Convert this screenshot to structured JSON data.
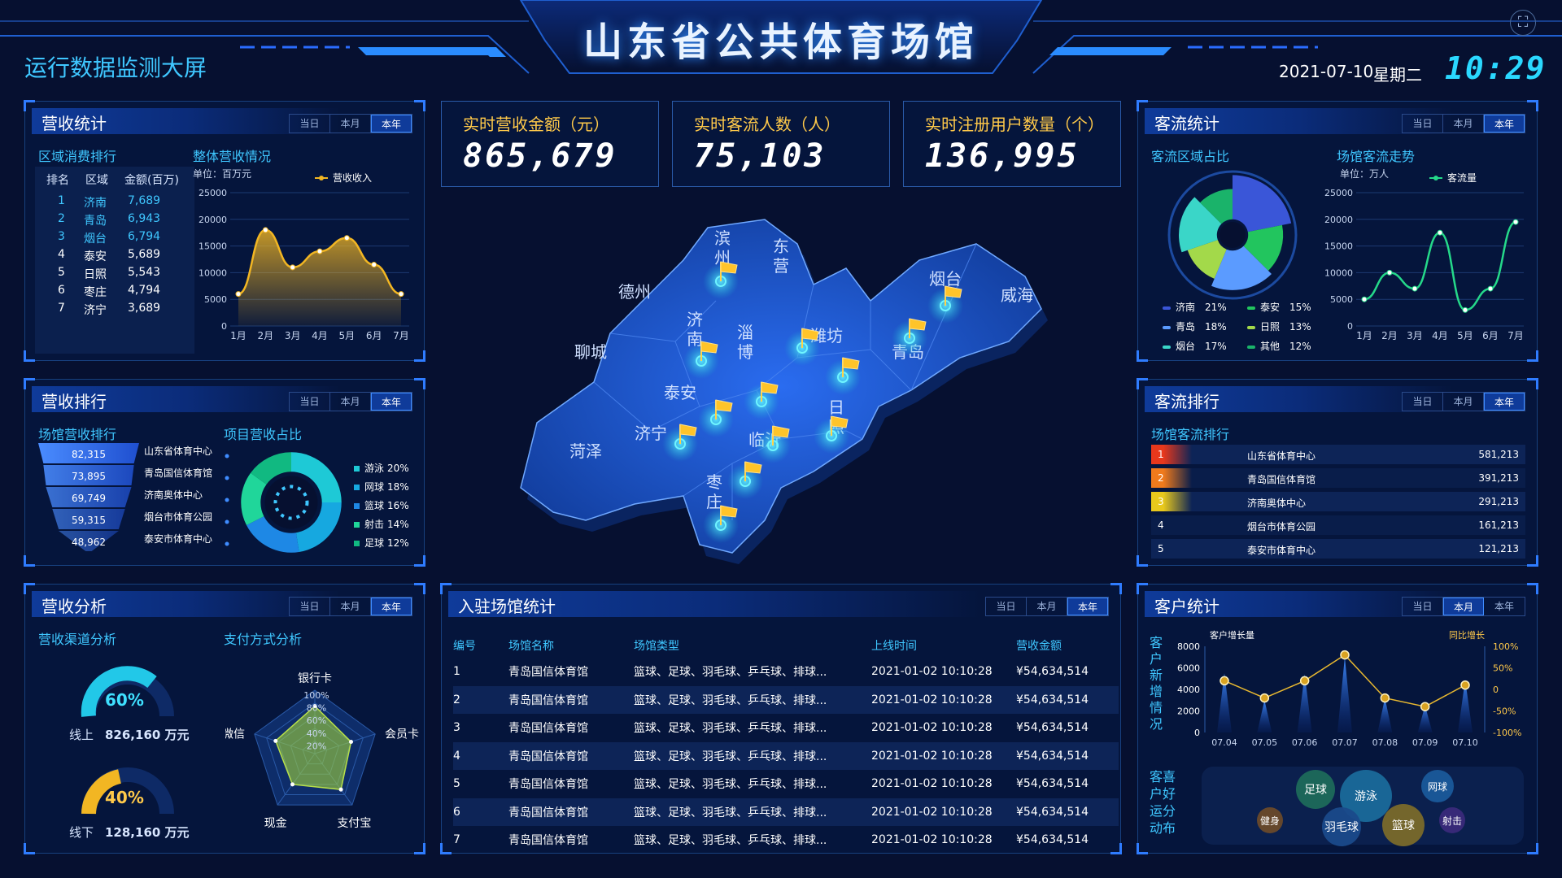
{
  "header": {
    "title": "山东省公共体育场馆",
    "subtitle": "运行数据监测大屏",
    "date": "2021-07-10",
    "weekday": "星期二",
    "time": "10:29"
  },
  "tabs": [
    "当日",
    "本月",
    "本年"
  ],
  "kpis": [
    {
      "label": "实时营收金额（元）",
      "value": "865,679"
    },
    {
      "label": "实时客流人数（人）",
      "value": "75,103"
    },
    {
      "label": "实时注册用户数量（个）",
      "value": "136,995"
    }
  ],
  "revenue_stats": {
    "title": "营收统计",
    "region_title": "区域消费排行",
    "headers": [
      "排名",
      "区域",
      "金额(百万)"
    ],
    "rows": [
      {
        "rank": "1",
        "region": "济南",
        "amount": "7,689"
      },
      {
        "rank": "2",
        "region": "青岛",
        "amount": "6,943"
      },
      {
        "rank": "3",
        "region": "烟台",
        "amount": "6,794"
      },
      {
        "rank": "4",
        "region": "泰安",
        "amount": "5,689"
      },
      {
        "rank": "5",
        "region": "日照",
        "amount": "5,543"
      },
      {
        "rank": "6",
        "region": "枣庄",
        "amount": "4,794"
      },
      {
        "rank": "7",
        "region": "济宁",
        "amount": "3,689"
      }
    ],
    "overall_title": "整体营收情况",
    "unit": "单位：百万元"
  },
  "revenue_rank": {
    "title": "营收排行",
    "venue_title": "场馆营收排行",
    "project_title": "项目营收占比",
    "funnel_values": [
      "82,315",
      "73,895",
      "69,749",
      "59,315",
      "48,962"
    ],
    "funnel_names": [
      "山东省体育中心",
      "青岛国信体育馆",
      "济南奥体中心",
      "烟台市体育公园",
      "泰安市体育中心"
    ]
  },
  "revenue_analysis": {
    "title": "营收分析",
    "channel_title": "营收渠道分析",
    "online_pct": "60%",
    "online_label": "线上",
    "online_value": "826,160 万元",
    "offline_pct": "40%",
    "offline_label": "线下",
    "offline_value": "128,160 万元",
    "payment_title": "支付方式分析",
    "radar_ticks": [
      "100%",
      "80%",
      "60%",
      "40%",
      "20%"
    ]
  },
  "venues": {
    "title": "入驻场馆统计",
    "headers": [
      "编号",
      "场馆名称",
      "场馆类型",
      "上线时间",
      "营收金额"
    ],
    "rows": [
      {
        "id": "1",
        "name": "青岛国信体育馆",
        "type": "篮球、足球、羽毛球、乒乓球、排球...",
        "time": "2021-01-02 10:10:28",
        "amount": "¥54,634,514"
      },
      {
        "id": "2",
        "name": "青岛国信体育馆",
        "type": "篮球、足球、羽毛球、乒乓球、排球...",
        "time": "2021-01-02 10:10:28",
        "amount": "¥54,634,514"
      },
      {
        "id": "3",
        "name": "青岛国信体育馆",
        "type": "篮球、足球、羽毛球、乒乓球、排球...",
        "time": "2021-01-02 10:10:28",
        "amount": "¥54,634,514"
      },
      {
        "id": "4",
        "name": "青岛国信体育馆",
        "type": "篮球、足球、羽毛球、乒乓球、排球...",
        "time": "2021-01-02 10:10:28",
        "amount": "¥54,634,514"
      },
      {
        "id": "5",
        "name": "青岛国信体育馆",
        "type": "篮球、足球、羽毛球、乒乓球、排球...",
        "time": "2021-01-02 10:10:28",
        "amount": "¥54,634,514"
      },
      {
        "id": "6",
        "name": "青岛国信体育馆",
        "type": "篮球、足球、羽毛球、乒乓球、排球...",
        "time": "2021-01-02 10:10:28",
        "amount": "¥54,634,514"
      },
      {
        "id": "7",
        "name": "青岛国信体育馆",
        "type": "篮球、足球、羽毛球、乒乓球、排球...",
        "time": "2021-01-02 10:10:28",
        "amount": "¥54,634,514"
      }
    ]
  },
  "traffic_stats": {
    "title": "客流统计",
    "region_title": "客流区域占比",
    "trend_title": "场馆客流走势",
    "unit": "单位：万人"
  },
  "traffic_rank": {
    "title": "客流排行",
    "subtitle": "场馆客流排行",
    "rows": [
      {
        "rank": "1",
        "name": "山东省体育中心",
        "value": "581,213",
        "color": "#e8381c"
      },
      {
        "rank": "2",
        "name": "青岛国信体育馆",
        "value": "391,213",
        "color": "#f07a1c"
      },
      {
        "rank": "3",
        "name": "济南奥体中心",
        "value": "291,213",
        "color": "#e8c81c"
      },
      {
        "rank": "4",
        "name": "烟台市体育公园",
        "value": "161,213",
        "color": ""
      },
      {
        "rank": "5",
        "name": "泰安市体育中心",
        "value": "121,213",
        "color": ""
      }
    ]
  },
  "customer_stats": {
    "title": "客户统计",
    "growth_vlabel": "客户新增情况",
    "pref_vlabel": "客喜户好运分动布",
    "bubbles": [
      {
        "label": "足球",
        "color": "#1e6a5a"
      },
      {
        "label": "游泳",
        "color": "#1a6a9a"
      },
      {
        "label": "网球",
        "color": "#1a5a9a"
      },
      {
        "label": "健身",
        "color": "#6a4a2a"
      },
      {
        "label": "羽毛球",
        "color": "#1a4a8a"
      },
      {
        "label": "篮球",
        "color": "#7a6a2a"
      },
      {
        "label": "射击",
        "color": "#3a2a7a"
      }
    ]
  },
  "map": {
    "cities": [
      "滨州",
      "东营",
      "德州",
      "烟台",
      "威海",
      "济南",
      "淄博",
      "潍坊",
      "青岛",
      "聊城",
      "泰安",
      "济宁",
      "日照",
      "临沂",
      "菏泽",
      "枣庄"
    ]
  },
  "chart_data": [
    {
      "type": "area",
      "title": "整体营收情况",
      "categories": [
        "1月",
        "2月",
        "3月",
        "4月",
        "5月",
        "6月",
        "7月"
      ],
      "series": [
        {
          "name": "营收收入",
          "values": [
            6000,
            18000,
            11000,
            14000,
            16500,
            11500,
            6000
          ]
        }
      ],
      "ylim": [
        0,
        25000
      ],
      "yticks": [
        0,
        5000,
        10000,
        15000,
        20000,
        25000
      ],
      "color": "#f2b623"
    },
    {
      "type": "line",
      "title": "场馆客流走势",
      "categories": [
        "1月",
        "2月",
        "3月",
        "4月",
        "5月",
        "6月",
        "7月"
      ],
      "series": [
        {
          "name": "客流量",
          "values": [
            5000,
            10000,
            7000,
            17500,
            3000,
            7000,
            19500
          ]
        }
      ],
      "ylim": [
        0,
        25000
      ],
      "yticks": [
        0,
        5000,
        10000,
        15000,
        20000,
        25000
      ],
      "color": "#25d98a"
    },
    {
      "type": "pie",
      "title": "客流区域占比",
      "labels": [
        "济南",
        "泰安",
        "青岛",
        "日照",
        "烟台",
        "其他"
      ],
      "pct_labels": [
        "21%",
        "15%",
        "18%",
        "13%",
        "17%",
        "12%"
      ],
      "values": [
        21,
        15,
        18,
        13,
        17,
        12
      ],
      "colors": [
        "#3a56d8",
        "#22c55e",
        "#5b9bff",
        "#a3d94a",
        "#3ad6c8",
        "#1ab36a"
      ]
    },
    {
      "type": "pie",
      "title": "项目营收占比",
      "labels": [
        "游泳",
        "网球",
        "篮球",
        "射击",
        "足球"
      ],
      "pct_labels": [
        "20%",
        "18%",
        "16%",
        "14%",
        "12%"
      ],
      "values": [
        20,
        18,
        16,
        14,
        12
      ],
      "colors": [
        "#1ec9d6",
        "#16a8e0",
        "#1e88e5",
        "#20d69a",
        "#11b981"
      ]
    },
    {
      "type": "bar",
      "title": "场馆营收排行",
      "categories": [
        "山东省体育中心",
        "青岛国信体育馆",
        "济南奥体中心",
        "烟台市体育公园",
        "泰安市体育中心"
      ],
      "values": [
        82315,
        73895,
        69749,
        59315,
        48962
      ]
    },
    {
      "type": "radar",
      "title": "支付方式分析",
      "axes": [
        "银行卡",
        "会员卡",
        "支付宝",
        "现金",
        "微信"
      ],
      "values": [
        75,
        60,
        70,
        60,
        65
      ]
    },
    {
      "type": "bar",
      "title": "客户增长量",
      "categories": [
        "07.04",
        "07.05",
        "07.06",
        "07.07",
        "07.08",
        "07.09",
        "07.10"
      ],
      "series": [
        {
          "name": "客户增长量",
          "values": [
            5500,
            3000,
            5400,
            7000,
            3200,
            2500,
            4900
          ]
        },
        {
          "name": "同比增长",
          "values": [
            20,
            -20,
            20,
            80,
            -20,
            -40,
            10
          ]
        }
      ],
      "ylim": [
        0,
        8000
      ],
      "yticks": [
        0,
        2000,
        4000,
        6000,
        8000
      ],
      "y2lim": [
        -100,
        100
      ],
      "y2ticks": [
        "-100%",
        "-50%",
        "0",
        "50%",
        "100%"
      ]
    }
  ]
}
